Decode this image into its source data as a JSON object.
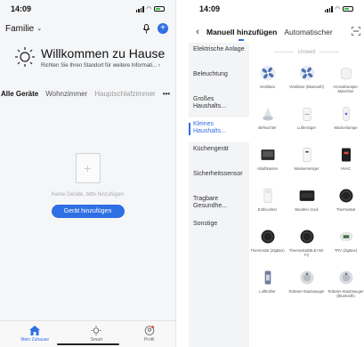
{
  "left": {
    "status_time": "14:09",
    "home_name": "Familie",
    "welcome_title": "Willkommen zu Hause",
    "welcome_sub": "Richten Sie Ihren Standort für weitere Informati...",
    "tabs": [
      "Alle Geräte",
      "Wohnzimmer",
      "Hauptschlafzimmer"
    ],
    "empty_text": "Keine Geräte, bitte hinzufügen",
    "add_button": "Gerät hinzufügen",
    "nav": [
      "Mein Zuhause",
      "Smart",
      "Profil"
    ]
  },
  "right": {
    "status_time": "14:09",
    "tabs": [
      "Manuell hinzufügen",
      "Automatischer"
    ],
    "categories": [
      "Elektrische Anlage",
      "Beleuchtung",
      "Großes Haushalts...",
      "Kleines Haushalts...",
      "Küchengerät",
      "Sicherheitssensor",
      "Tragbare Gesundhe...",
      "Sonstige"
    ],
    "section": "Umwelt",
    "devices": [
      {
        "name": "Ventilator",
        "icon": "fan-icon"
      },
      {
        "name": "Ventilator (Bluetooth)",
        "icon": "fan-icon"
      },
      {
        "name": "Aromatherapie-Maschine",
        "icon": "aroma-icon"
      },
      {
        "name": "Befeuchter",
        "icon": "humidifier-icon"
      },
      {
        "name": "Luftreiniger",
        "icon": "purifier-icon"
      },
      {
        "name": "Mückenlampe",
        "icon": "lamp-icon"
      },
      {
        "name": "Abluftkanten",
        "icon": "heater-icon"
      },
      {
        "name": "Wasserreiniger",
        "icon": "water-icon"
      },
      {
        "name": "HVAC",
        "icon": "hvac-icon"
      },
      {
        "name": "Entfeuchter",
        "icon": "dehumidifier-icon"
      },
      {
        "name": "Weather clock",
        "icon": "clock-icon"
      },
      {
        "name": "Thermostat",
        "icon": "thermostat-icon"
      },
      {
        "name": "Thermostat (ZigBee)",
        "icon": "thermostat-icon"
      },
      {
        "name": "Thermostat(BLE+Wi-Fi)",
        "icon": "thermostat-icon"
      },
      {
        "name": "TRV (ZigBee)",
        "icon": "trv-icon"
      },
      {
        "name": "Luftkühler",
        "icon": "cooler-icon"
      },
      {
        "name": "Roboter-Staubsauger",
        "icon": "robot-icon"
      },
      {
        "name": "Roboter-Staubsauger (Bluetooth)",
        "icon": "robot-icon"
      }
    ]
  }
}
